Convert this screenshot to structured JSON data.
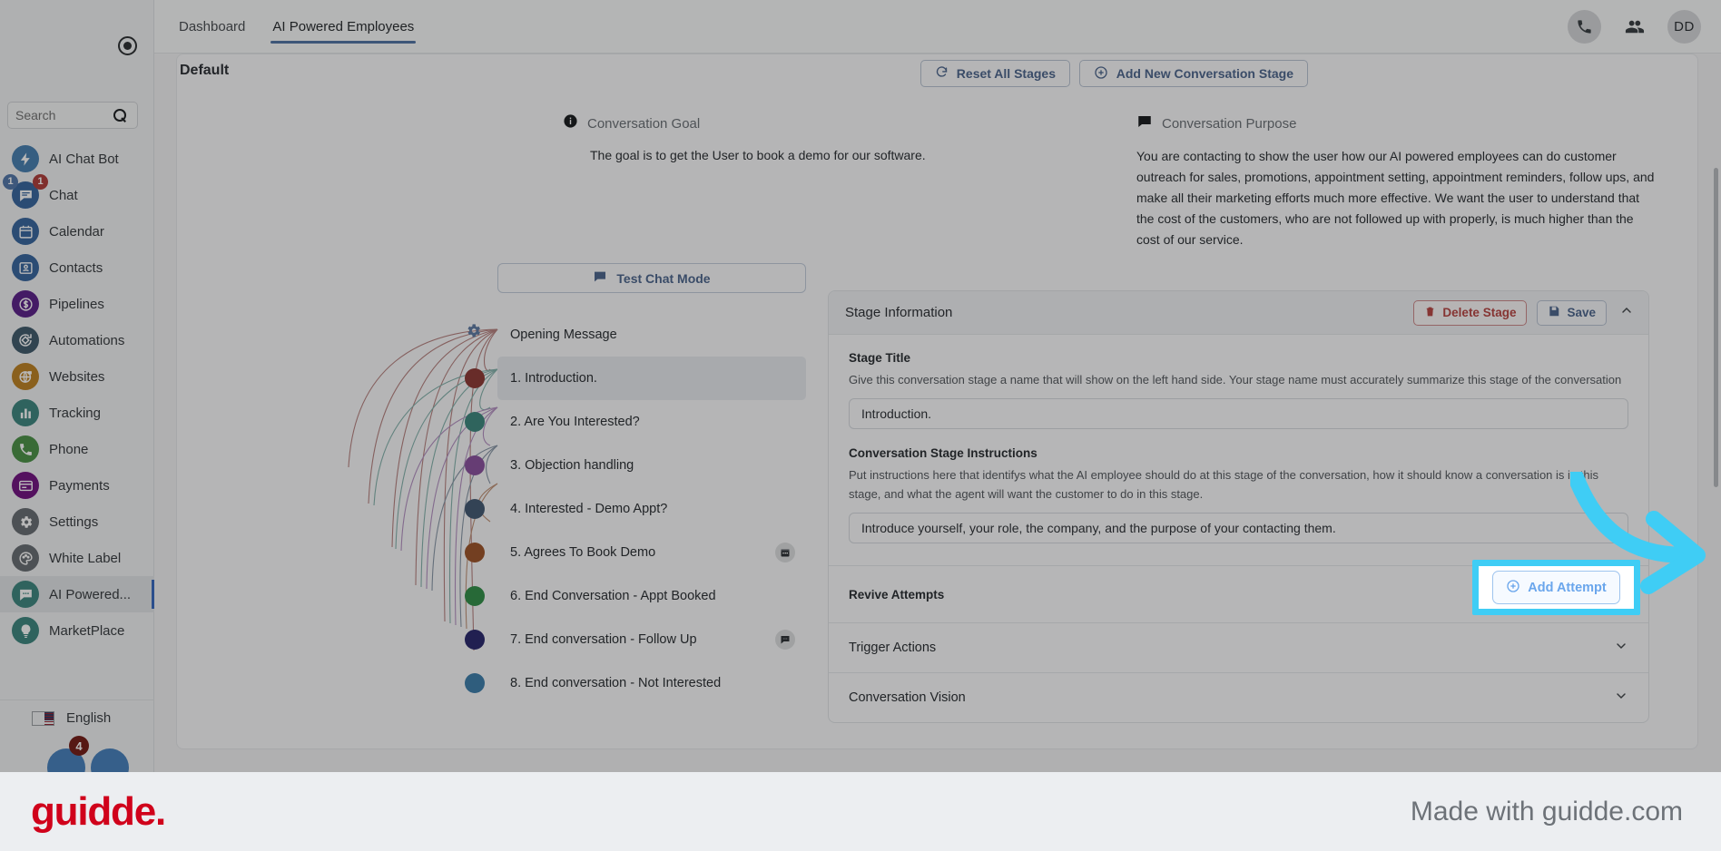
{
  "sidebar": {
    "collapse_icon": "collapse-circle-icon",
    "search": {
      "placeholder": "Search",
      "value": "",
      "icon": "search-icon"
    },
    "items": [
      {
        "label": "AI Chat Bot",
        "icon": "lightning-icon",
        "color": "#3b86c6",
        "badges": []
      },
      {
        "label": "Chat",
        "icon": "chat-bubble-icon",
        "color": "#2f6cb5",
        "badges": [
          "1",
          "1"
        ]
      },
      {
        "label": "Calendar",
        "icon": "calendar-icon",
        "color": "#2f6cb5",
        "badges": []
      },
      {
        "label": "Contacts",
        "icon": "contact-card-icon",
        "color": "#2f6cb5",
        "badges": []
      },
      {
        "label": "Pipelines",
        "icon": "dollar-circle-icon",
        "color": "#6b1fa8",
        "badges": []
      },
      {
        "label": "Automations",
        "icon": "automation-icon",
        "color": "#3d6077",
        "badges": []
      },
      {
        "label": "Websites",
        "icon": "globe-lock-icon",
        "color": "#d18407",
        "badges": []
      },
      {
        "label": "Tracking",
        "icon": "bar-chart-icon",
        "color": "#2e8f86",
        "badges": []
      },
      {
        "label": "Phone",
        "icon": "phone-icon",
        "color": "#3e9b3a",
        "badges": []
      },
      {
        "label": "Payments",
        "icon": "credit-card-icon",
        "color": "#8b0f9e",
        "badges": []
      },
      {
        "label": "Settings",
        "icon": "gear-icon",
        "color": "#6a7078",
        "badges": []
      },
      {
        "label": "White Label",
        "icon": "palette-icon",
        "color": "#6a7078",
        "badges": []
      },
      {
        "label": "AI Powered...",
        "icon": "ai-chat-icon",
        "color": "#2e8f86",
        "badges": [],
        "active": true
      },
      {
        "label": "MarketPlace",
        "icon": "bulb-icon",
        "color": "#2e8f86",
        "badges": []
      }
    ],
    "language": {
      "label": "English",
      "flag": "us-flag-icon"
    },
    "bottom_badge": "4"
  },
  "topbar": {
    "tabs": [
      {
        "label": "Dashboard",
        "selected": false
      },
      {
        "label": "AI Powered Employees",
        "selected": true
      }
    ],
    "icons": [
      "phone-icon",
      "people-icon"
    ],
    "avatar_initials": "DD"
  },
  "content": {
    "section_label": "Default",
    "reset_button": "Reset All Stages",
    "reset_icon": "refresh-icon",
    "add_stage_button": "Add New Conversation Stage",
    "add_stage_icon": "plus-circle-icon",
    "goal": {
      "icon": "info-icon",
      "title": "Conversation Goal",
      "text": "The goal is to get the User to book a demo for our software."
    },
    "purpose": {
      "icon": "message-icon",
      "title": "Conversation Purpose",
      "text": "You are contacting to show the user how our AI powered employees can do customer outreach for sales, promotions, appointment setting, appointment reminders, follow ups, and make all their marketing efforts much more effective. We want the user to understand that the cost of the customers, who are not followed up with properly, is much higher than the cost of our service."
    },
    "test_chat_button": "Test Chat Mode",
    "test_chat_icon": "chat-icon",
    "opening_message": {
      "label": "Opening Message",
      "icon": "gear-icon"
    },
    "stages": [
      {
        "label": "1. Introduction.",
        "color": "#a73732",
        "selected": true,
        "right_icon": ""
      },
      {
        "label": "2. Are You Interested?",
        "color": "#2f9083",
        "selected": false,
        "right_icon": ""
      },
      {
        "label": "3. Objection handling",
        "color": "#9a4fb5",
        "selected": false,
        "right_icon": ""
      },
      {
        "label": "4. Interested - Demo Appt?",
        "color": "#415e80",
        "selected": false,
        "right_icon": ""
      },
      {
        "label": "5. Agrees To Book Demo",
        "color": "#b4531b",
        "selected": false,
        "right_icon": "calendar-icon"
      },
      {
        "label": "6. End Conversation - Appt Booked",
        "color": "#1f9a3e",
        "selected": false,
        "right_icon": ""
      },
      {
        "label": "7. End conversation - Follow Up",
        "color": "#2d2a86",
        "selected": false,
        "right_icon": "chat-icon"
      },
      {
        "label": "8. End conversation - Not Interested",
        "color": "#2f85c0",
        "selected": false,
        "right_icon": ""
      }
    ]
  },
  "panel": {
    "title": "Stage Information",
    "delete_button": "Delete Stage",
    "delete_icon": "trash-icon",
    "save_button": "Save",
    "save_icon": "save-disk-icon",
    "collapse_icon": "chevron-up-icon",
    "stage_title": {
      "label": "Stage Title",
      "hint": "Give this conversation stage a name that will show on the left hand side. Your stage name must accurately summarize this stage of the conversation",
      "value": "Introduction."
    },
    "stage_instructions": {
      "label": "Conversation Stage Instructions",
      "hint": "Put instructions here that identifys what the AI employee should do at this stage of the conversation, how it should know a conversation is in this stage, and what the agent will want the customer to do in this stage.",
      "value": "Introduce yourself, your role, the company, and the purpose of your contacting them."
    },
    "revive_attempts": {
      "label": "Revive Attempts",
      "add_button": "Add Attempt",
      "add_icon": "plus-circle-icon"
    },
    "accordions": [
      {
        "label": "Trigger Actions",
        "icon": "chevron-down-icon"
      },
      {
        "label": "Conversation Vision",
        "icon": "chevron-down-icon"
      }
    ]
  },
  "annotation": {
    "highlight_color": "#3fcdf5",
    "arrow_icon": "curved-arrow-icon",
    "target": "Add Attempt"
  },
  "footer": {
    "logo": "guidde.",
    "tagline": "Made with guidde.com"
  }
}
